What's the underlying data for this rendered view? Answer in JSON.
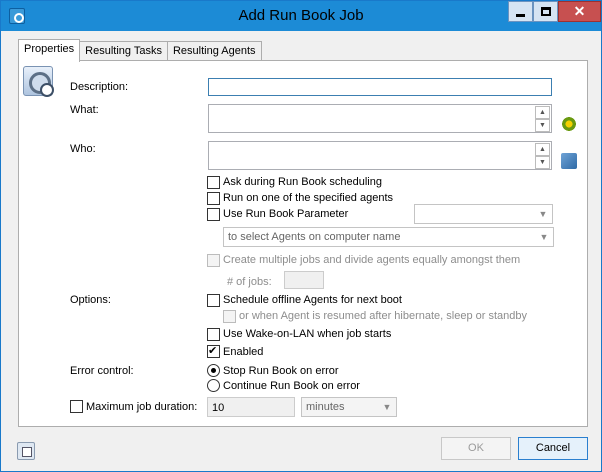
{
  "window": {
    "title": "Add Run Book Job",
    "close_glyph": "✕"
  },
  "tabs": [
    {
      "label": "Properties",
      "active": true
    },
    {
      "label": "Resulting Tasks",
      "active": false
    },
    {
      "label": "Resulting Agents",
      "active": false
    }
  ],
  "form": {
    "description_label": "Description:",
    "description_value": "",
    "what_label": "What:",
    "who_label": "Who:",
    "ask_scheduling": {
      "label": "Ask during Run Book scheduling",
      "checked": false
    },
    "run_on_one": {
      "label": "Run on one of the specified agents",
      "checked": false
    },
    "use_param": {
      "label": "Use Run Book Parameter",
      "checked": false,
      "combo_value": ""
    },
    "agents_combo": "to select Agents on computer name",
    "create_multiple": {
      "label": "Create multiple jobs and divide agents equally amongst them",
      "checked": false
    },
    "num_jobs_label": "# of jobs:",
    "num_jobs_value": "",
    "options_label": "Options:",
    "schedule_offline": {
      "label": "Schedule offline Agents for next boot",
      "checked": false
    },
    "resumed": {
      "label": "or when Agent is resumed after hibernate, sleep or standby",
      "checked": false
    },
    "wake_on_lan": {
      "label": "Use Wake-on-LAN when job starts",
      "checked": false
    },
    "enabled": {
      "label": "Enabled",
      "checked": true
    },
    "error_control_label": "Error control:",
    "stop_on_error": {
      "label": "Stop Run Book on error",
      "selected": true
    },
    "continue_on_error": {
      "label": "Continue Run Book on error",
      "selected": false
    },
    "max_duration": {
      "label": "Maximum job duration:",
      "checked": false,
      "value": "10",
      "unit": "minutes"
    }
  },
  "buttons": {
    "ok": "OK",
    "cancel": "Cancel"
  },
  "icons": {
    "app": "runbook-gear-icon",
    "what_picker": "gear-plus-icon",
    "who_picker": "agents-icon",
    "bottom": "window-icon"
  }
}
